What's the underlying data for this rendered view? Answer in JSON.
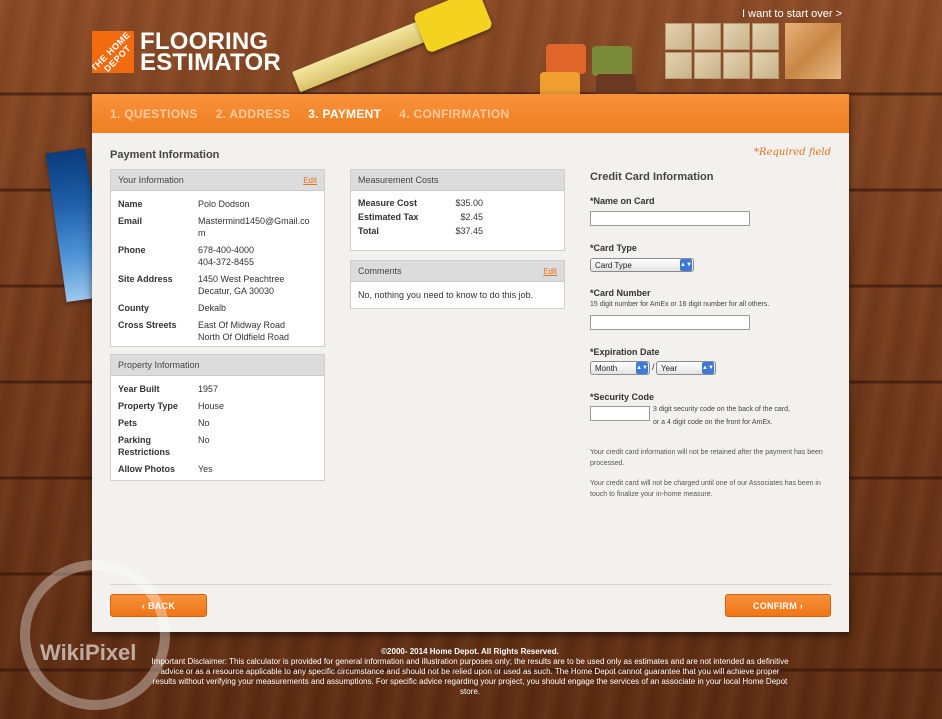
{
  "header": {
    "logo_text": "THE HOME DEPOT",
    "title_line1": "FLOORING",
    "title_line2": "ESTIMATOR",
    "start_over": "I want to start over >"
  },
  "steps": [
    {
      "label": "1. QUESTIONS",
      "active": false
    },
    {
      "label": "2. ADDRESS",
      "active": false
    },
    {
      "label": "3. PAYMENT",
      "active": true
    },
    {
      "label": "4. CONFIRMATION",
      "active": false
    }
  ],
  "page": {
    "section_title": "Payment Information",
    "required_note": "*Required field"
  },
  "your_info": {
    "title": "Your Information",
    "edit": "Edit",
    "rows": [
      {
        "k": "Name",
        "v": "Polo Dodson"
      },
      {
        "k": "Email",
        "v": "Mastermind1450@Gmail.co\nm"
      },
      {
        "k": "Phone",
        "v": "678-400-4000\n404-372-8455"
      },
      {
        "k": "Site Address",
        "v": "1450 West Peachtree\nDecatur, GA 30030"
      },
      {
        "k": "County",
        "v": "Dekalb"
      },
      {
        "k": "Cross Streets",
        "v": "East Of Midway Road\nNorth Of Oldfield Road"
      }
    ]
  },
  "property_info": {
    "title": "Property Information",
    "rows": [
      {
        "k": "Year Built",
        "v": "1957"
      },
      {
        "k": "Property Type",
        "v": "House"
      },
      {
        "k": "Pets",
        "v": "No"
      },
      {
        "k": "Parking\nRestrictions",
        "v": "No"
      },
      {
        "k": "Allow Photos",
        "v": "Yes"
      }
    ]
  },
  "costs": {
    "title": "Measurement Costs",
    "rows": [
      {
        "k": "Measure Cost",
        "v": "$35.00"
      },
      {
        "k": "Estimated Tax",
        "v": "$2.45"
      },
      {
        "k": "Total",
        "v": "$37.45"
      }
    ]
  },
  "comments": {
    "title": "Comments",
    "edit": "Edit",
    "text": "No, nothing you need to know to do this job."
  },
  "credit_card": {
    "title": "Credit Card Information",
    "name_label": "*Name on Card",
    "name_value": "",
    "type_label": "*Card Type",
    "type_value": "Card Type",
    "number_label": "*Card Number",
    "number_hint": "15 digit number for AmEx or 16 digit number for all others.",
    "number_value": "",
    "exp_label": "*Expiration Date",
    "month_value": "Month",
    "exp_sep": "/",
    "year_value": "Year",
    "sec_label": "*Security Code",
    "sec_value": "",
    "sec_hint1": "3 digit security code on the back of the card,",
    "sec_hint2": "or a 4 digit code on the front for AmEx.",
    "note1": "Your credit card information will not be retained after the payment has been processed.",
    "note2": "Your credit card will not be charged until one of our Associates has been in touch to finalize your in-home measure."
  },
  "buttons": {
    "back": "‹ BACK",
    "confirm": "CONFIRM ›"
  },
  "footer": {
    "copyright": "©2000- 2014 Home Depot. All Rights Reserved.",
    "disclaimer": "Important Disclaimer: This calculator is provided for general information and illustration purposes only; the results are to be used only as estimates and are not intended as definitive advice or as a resource applicable to any specific circumstance and should not be relied upon or used as such. The Home Depot cannot guarantee that you will achieve proper results without verifying your measurements and assumptions. For specific advice regarding your project, you should engage the services of an associate in your local Home Depot store."
  },
  "watermark": "WikiPixel",
  "colors": {
    "accent": "#f07f22",
    "card_bg": "#f2f1ef",
    "link": "#e8701f"
  }
}
